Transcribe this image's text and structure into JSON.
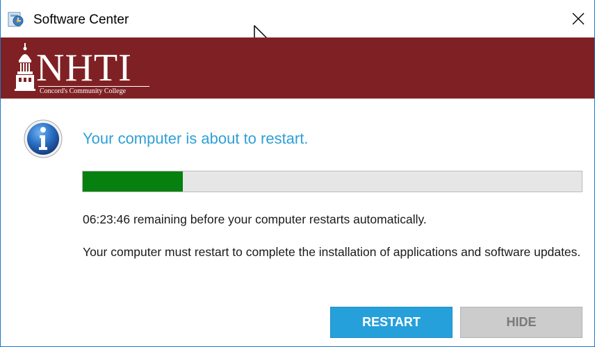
{
  "window": {
    "title": "Software Center",
    "app_icon": "software-center-icon",
    "close_icon": "close-icon",
    "cursor_icon": "mouse-pointer-icon"
  },
  "banner": {
    "logo_name": "NHTI",
    "logo_tagline": "Concord's Community College",
    "logo_icon": "dome-building-icon",
    "background_color": "#7f2124"
  },
  "dialog": {
    "info_icon": "info-icon",
    "headline": "Your computer is about to restart.",
    "headline_color": "#2f9fd7",
    "progress": {
      "fraction": 0.2,
      "fill_color": "#06800e"
    },
    "countdown_text": "06:23:46 remaining before your computer restarts automatically.",
    "message": "Your computer must restart to complete the installation of applications and software updates."
  },
  "buttons": {
    "restart_label": "RESTART",
    "hide_label": "HIDE",
    "restart_color": "#26a0da"
  }
}
